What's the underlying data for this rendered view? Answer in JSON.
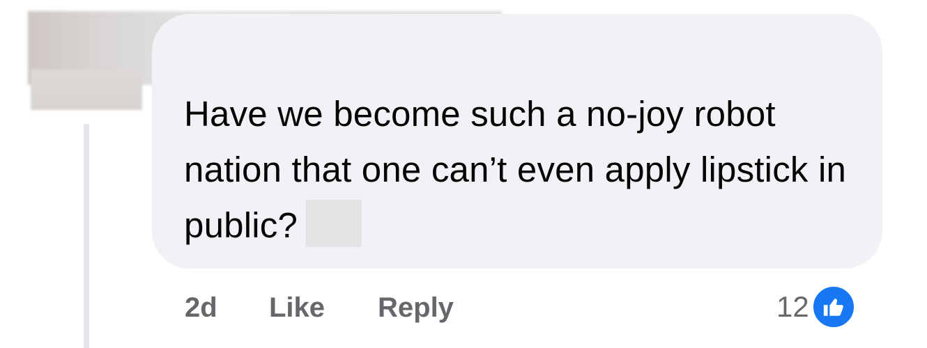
{
  "comment": {
    "text": "Have we become such a no-joy robot nation that one can’t even apply lipstick in public?"
  },
  "actions": {
    "time": "2d",
    "like_label": "Like",
    "reply_label": "Reply"
  },
  "reactions": {
    "count": "12",
    "icon": "thumbs-up-icon",
    "badge_color": "#1877f2"
  },
  "colors": {
    "bubble": "#f0f2f5",
    "text": "#050505",
    "muted": "#65676b"
  }
}
